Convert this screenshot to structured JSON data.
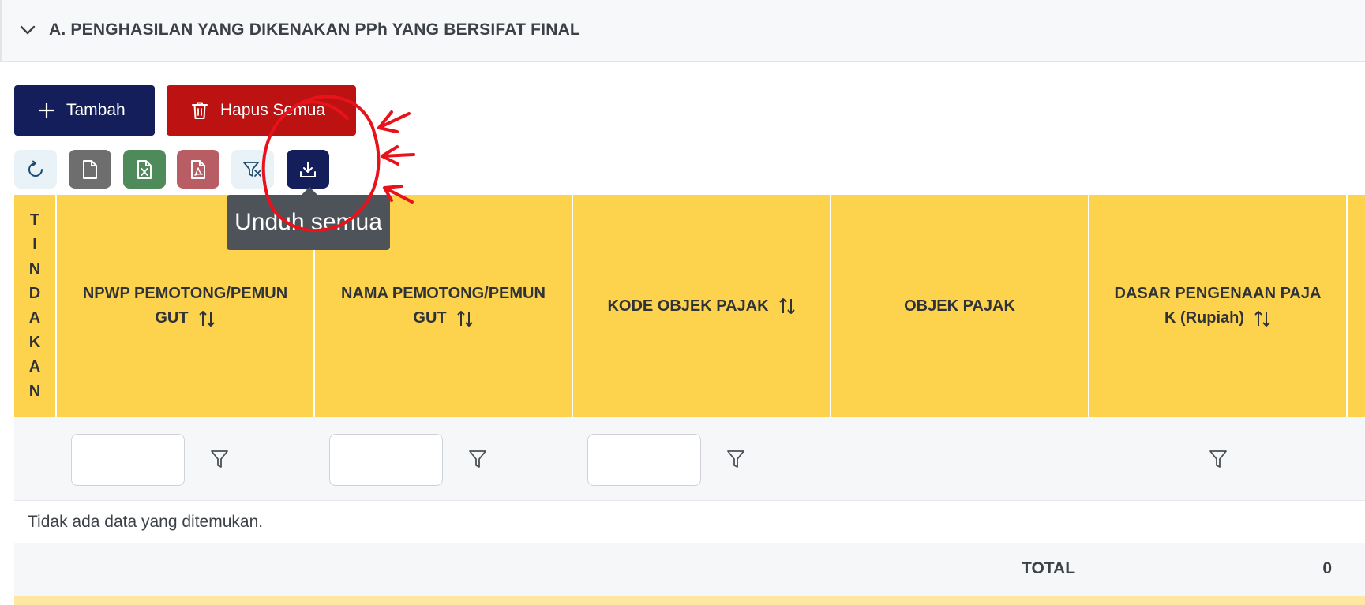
{
  "section": {
    "title": "A. PENGHASILAN YANG DIKENAKAN PPh YANG BERSIFAT FINAL",
    "chevron_icon": "chevron-down-icon"
  },
  "actions": {
    "add_label": "Tambah",
    "delete_all_label": "Hapus Semua"
  },
  "toolbar": {
    "items": [
      "refresh-icon",
      "file-icon",
      "excel-icon",
      "pdf-icon",
      "filter-clear-icon",
      "download-icon"
    ],
    "tooltip": "Unduh semua"
  },
  "table": {
    "columns": [
      {
        "label": "TINDAKAN",
        "sortable": false
      },
      {
        "label": "NPWP PEMOTONG/PEMUNGUT",
        "sortable": true
      },
      {
        "label": "NAMA PEMOTONG/PEMUNGUT",
        "sortable": true
      },
      {
        "label": "KODE OBJEK PAJAK",
        "sortable": true
      },
      {
        "label": "OBJEK PAJAK",
        "sortable": false
      },
      {
        "label": "DASAR PENGENAAN PAJAK (Rupiah)",
        "sortable": true
      }
    ],
    "header_lines": {
      "aksi": [
        "T",
        "I",
        "N",
        "D",
        "A",
        "K",
        "A",
        "N"
      ],
      "npwp": [
        "NPWP PEMOTONG/PEMUN",
        "GUT"
      ],
      "nama": [
        "NAMA PEMOTONG/PEMUN",
        "GUT"
      ],
      "kode": "KODE OBJEK PAJAK",
      "objek": "OBJEK PAJAK",
      "dasar": [
        "DASAR PENGENAAN PAJA",
        "K (Rupiah)"
      ]
    },
    "empty_message": "Tidak ada data yang ditemukan.",
    "total_label": "TOTAL",
    "total_value": "0"
  },
  "colors": {
    "header_bg": "#fdd24d",
    "primary": "#141e5a",
    "danger": "#bd1212",
    "annotation": "#e8121b"
  }
}
